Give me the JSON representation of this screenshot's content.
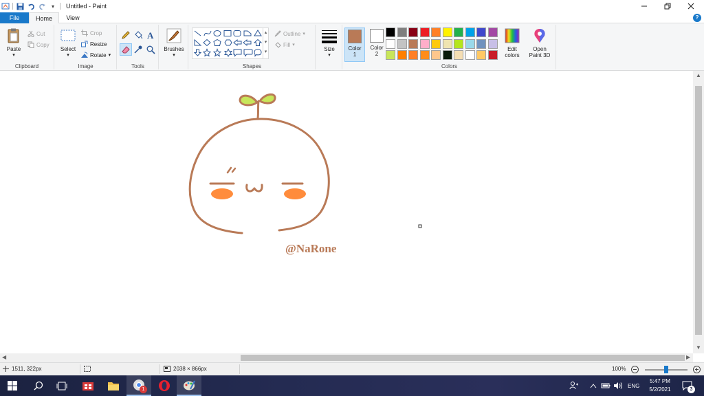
{
  "window": {
    "title": "Untitled - Paint",
    "controls": [
      "minimize",
      "restore",
      "close"
    ]
  },
  "tabs": [
    {
      "label": "File",
      "active": false,
      "accent": true
    },
    {
      "label": "Home",
      "active": true
    },
    {
      "label": "View",
      "active": false
    }
  ],
  "ribbon": {
    "clipboard": {
      "label": "Clipboard",
      "paste": "Paste",
      "cut": "Cut",
      "copy": "Copy"
    },
    "image": {
      "label": "Image",
      "select": "Select",
      "crop": "Crop",
      "resize": "Resize",
      "rotate": "Rotate"
    },
    "tools": {
      "label": "Tools"
    },
    "brushes": {
      "label": "Brushes"
    },
    "shapes": {
      "label": "Shapes",
      "outline": "Outline",
      "fill": "Fill"
    },
    "size": {
      "label": "Size"
    },
    "colors": {
      "label": "Colors",
      "color1_label": "Color",
      "color1_num": "1",
      "color1_value": "#b97a57",
      "color2_label": "Color",
      "color2_num": "2",
      "color2_value": "#ffffff",
      "edit_colors": "Edit colors",
      "open_paint3d": "Open Paint 3D",
      "palette_row1": [
        "#000000",
        "#7f7f7f",
        "#880015",
        "#ed1c24",
        "#ff7f27",
        "#fff200",
        "#22b14c",
        "#00a2e8",
        "#3f48cc",
        "#a349a4"
      ],
      "palette_row2": [
        "#ffffff",
        "#c3c3c3",
        "#b97a57",
        "#ffaec9",
        "#ffc90e",
        "#efe4b0",
        "#b5e61d",
        "#99d9ea",
        "#7092be",
        "#c8bfe7"
      ],
      "palette_row3": [
        "#c8e65a",
        "#ff7f00",
        "#ff7f27",
        "#ff8c1a",
        "#ffc68c",
        "#0a1a0a",
        "#f5deb3",
        "#ffffff",
        "#ffc864",
        "#c81e28"
      ]
    }
  },
  "canvas": {
    "signature": "@NaRone",
    "drawing": {
      "stroke_color": "#b97a57",
      "leaf_color": "#c8e65a",
      "cheek_color": "#ff8c3c"
    }
  },
  "status": {
    "cursor_pos": "1511, 322px",
    "canvas_size": "2038 × 866px",
    "zoom": "100%"
  },
  "taskbar": {
    "time": "5:47 PM",
    "date": "5/2/2021",
    "lang": "ENG",
    "notification_count": "3",
    "chrome_badge": "1"
  }
}
